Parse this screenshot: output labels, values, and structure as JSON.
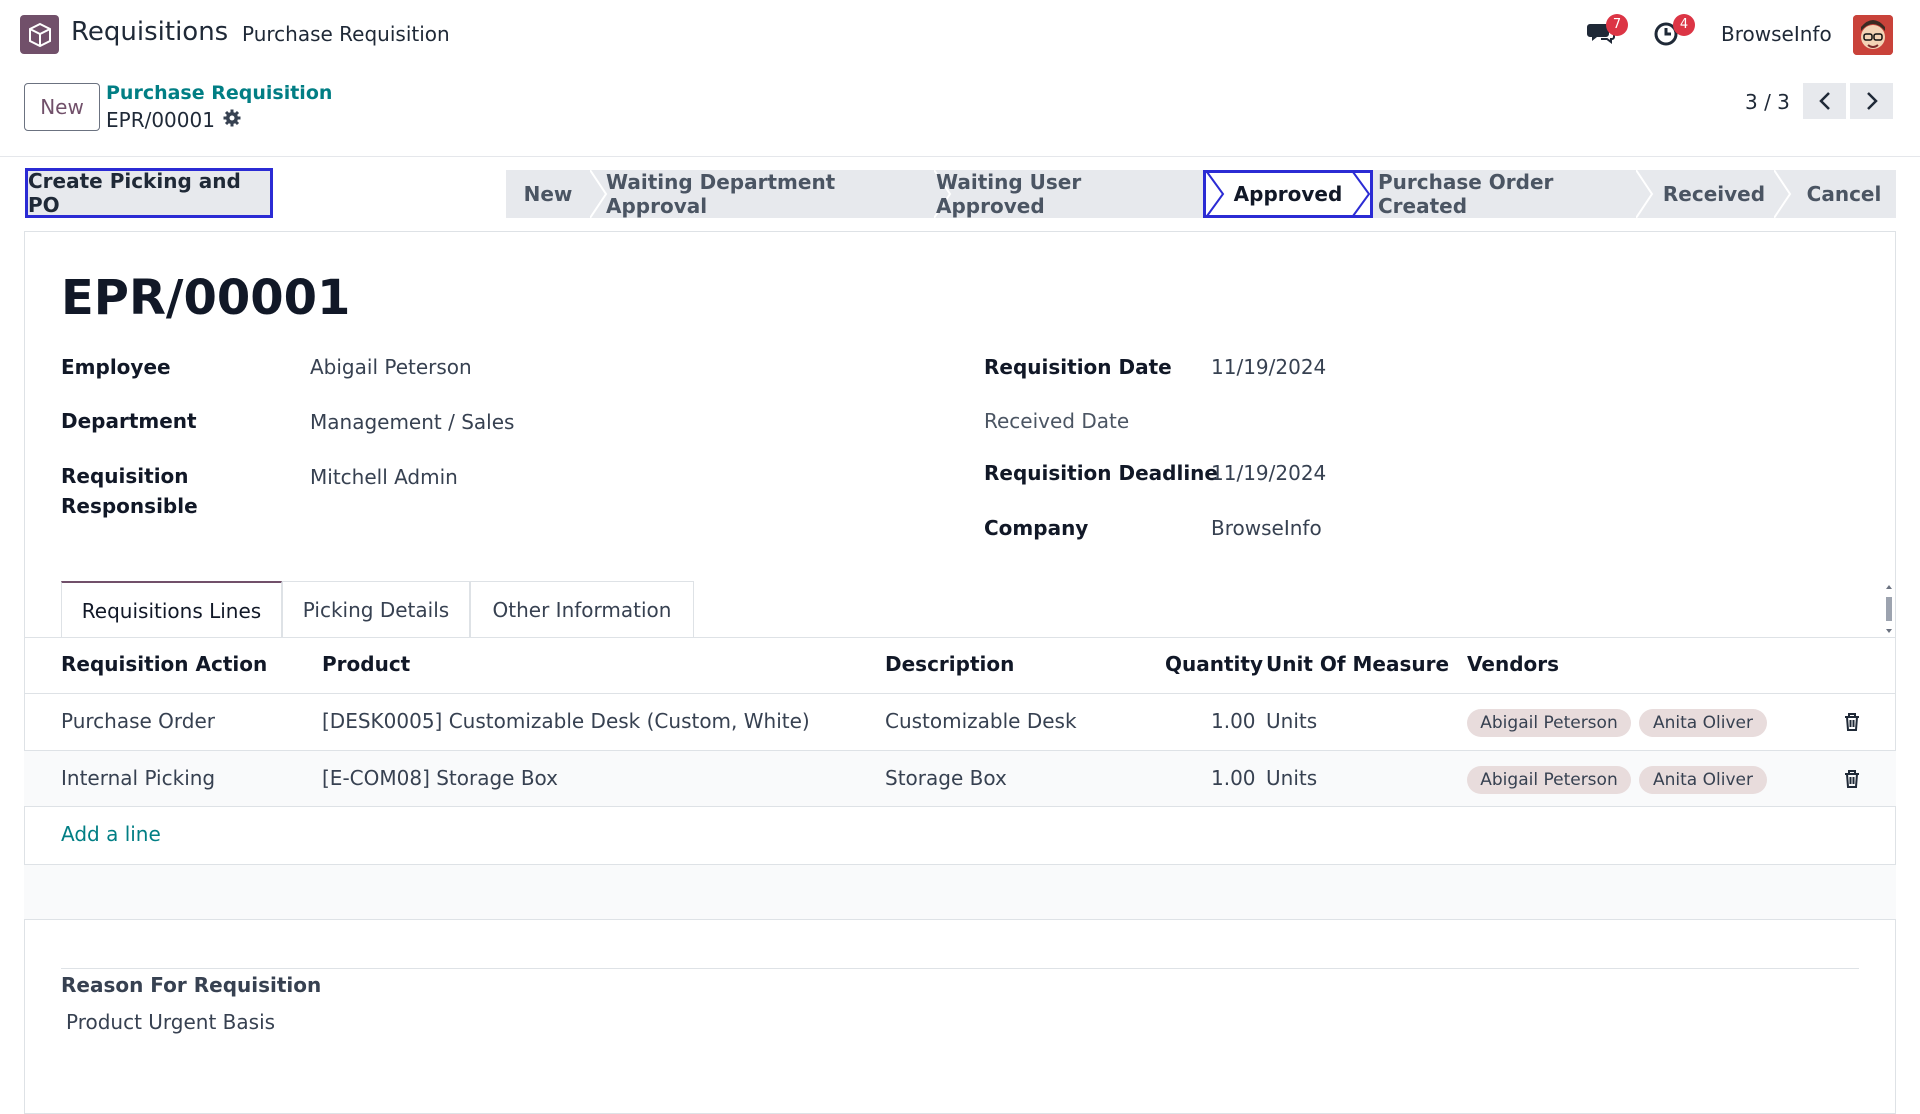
{
  "navbar": {
    "app_name": "Requisitions",
    "menu": "Purchase Requisition",
    "messages_count": "7",
    "activities_count": "4",
    "company": "BrowseInfo"
  },
  "control": {
    "new_label": "New",
    "breadcrumb": "Purchase Requisition",
    "record": "EPR/00001",
    "pager": "3 / 3"
  },
  "actions": {
    "create_picking": "Create Picking and PO"
  },
  "stages": [
    "New",
    "Waiting Department Approval",
    "Waiting User Approved",
    "Approved",
    "Purchase Order Created",
    "Received",
    "Cancel"
  ],
  "active_stage": "Approved",
  "form": {
    "title": "EPR/00001",
    "employee_label": "Employee",
    "employee": "Abigail Peterson",
    "department_label": "Department",
    "department": "Management / Sales",
    "responsible_label_1": "Requisition",
    "responsible_label_2": "Responsible",
    "responsible": "Mitchell Admin",
    "req_date_label": "Requisition Date",
    "req_date": "11/19/2024",
    "received_date_label": "Received Date",
    "deadline_label": "Requisition Deadline",
    "deadline": "11/19/2024",
    "company_label": "Company",
    "company": "BrowseInfo"
  },
  "tabs": [
    "Requisitions Lines",
    "Picking Details",
    "Other Information"
  ],
  "table": {
    "headers": [
      "Requisition Action",
      "Product",
      "Description",
      "Quantity",
      "Unit Of Measure",
      "Vendors"
    ],
    "rows": [
      {
        "action": "Purchase Order",
        "product": "[DESK0005] Customizable Desk (Custom, White)",
        "description": "Customizable Desk",
        "quantity": "1.00",
        "uom": "Units",
        "vendors": [
          "Abigail Peterson",
          "Anita Oliver"
        ]
      },
      {
        "action": "Internal Picking",
        "product": "[E-COM08] Storage Box",
        "description": "Storage Box",
        "quantity": "1.00",
        "uom": "Units",
        "vendors": [
          "Abigail Peterson",
          "Anita Oliver"
        ]
      }
    ],
    "add_line": "Add a line"
  },
  "reason": {
    "label": "Reason For Requisition",
    "value": "Product Urgent Basis"
  },
  "colors": {
    "brand": "#71506a",
    "link": "#017e84",
    "highlight": "#2b2bd4",
    "badge": "#dc3545"
  }
}
